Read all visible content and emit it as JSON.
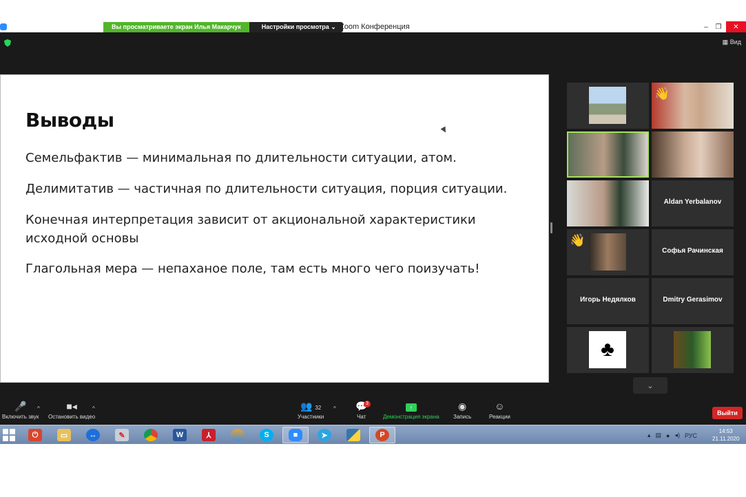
{
  "window": {
    "title": "Zoom Конференция",
    "share_banner_text": "Вы просматриваете экран Илья Макарчук",
    "view_options_label": "Настройки просмотра ⌄",
    "view_label": "Вид"
  },
  "slide": {
    "title": "Выводы",
    "points": [
      "Семельфактив — минимальная по длительности ситуации, атом.",
      "Делимитатив — частичная по длительности ситуация, порция ситуации.",
      "Конечная интерпретация зависит от акциональной характеристики исходной основы",
      "Глагольная мера — непаханое поле, там есть много чего поизучать!"
    ]
  },
  "gallery": {
    "named_tiles": [
      "Aldan Yerbalanov",
      "Софья Рачинская",
      "Игорь Недялков",
      "Dmitry Gerasimov"
    ]
  },
  "toolbar": {
    "unmute_label": "Включить звук",
    "stop_video_label": "Остановить видео",
    "participants_label": "Участники",
    "participants_count": "32",
    "chat_label": "Чат",
    "chat_badge": "3",
    "share_label": "Демонстрация экрана",
    "record_label": "Запись",
    "reactions_label": "Реакции",
    "leave_label": "Выйти"
  },
  "taskbar": {
    "language": "РУС",
    "time": "14:53",
    "date": "21.11.2020",
    "apps": [
      "power-app",
      "file-explorer",
      "teamviewer",
      "paint",
      "chrome",
      "word",
      "acrobat",
      "media-app",
      "skype",
      "zoom",
      "telegram",
      "python",
      "powerpoint"
    ]
  },
  "colors": {
    "share_banner_green": "#52b52b",
    "active_speaker_border": "#a4e25a",
    "share_green": "#2fd05a",
    "leave_red": "#d42525",
    "close_red": "#e81123"
  }
}
